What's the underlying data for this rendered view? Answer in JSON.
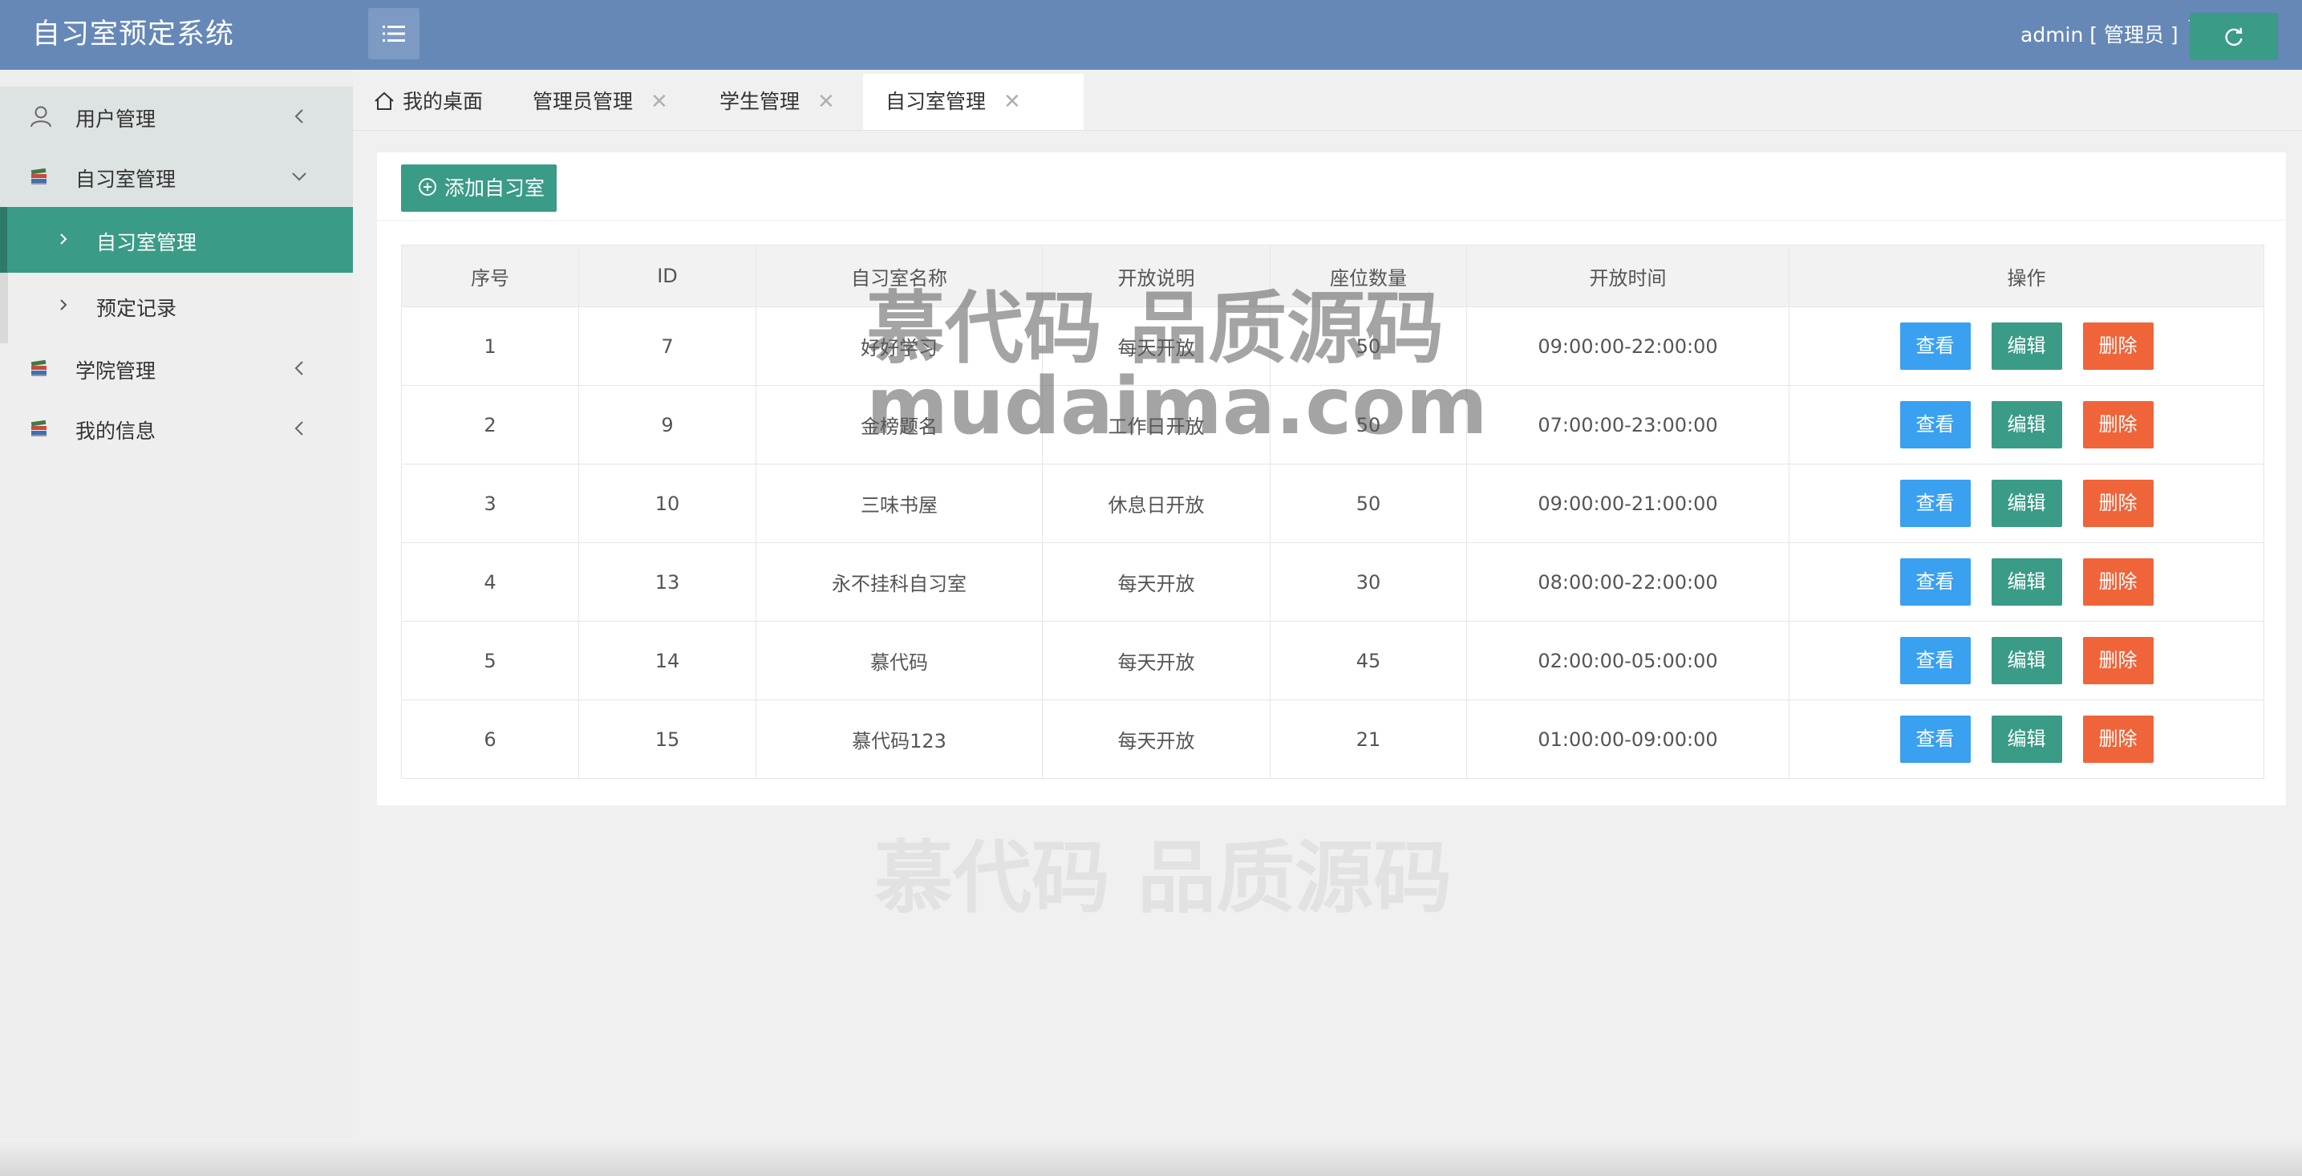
{
  "header": {
    "app_title": "自习室预定系统",
    "user_label": "admin [ 管理员 ]"
  },
  "sidebar": {
    "items": [
      {
        "label": "用户管理",
        "icon": "user-icon",
        "state": "collapsed"
      },
      {
        "label": "自习室管理",
        "icon": "books-icon",
        "state": "expanded"
      },
      {
        "label": "学院管理",
        "icon": "books-icon",
        "state": "collapsed"
      },
      {
        "label": "我的信息",
        "icon": "books-icon",
        "state": "collapsed"
      }
    ],
    "subitems": [
      {
        "label": "自习室管理",
        "active": true
      },
      {
        "label": "预定记录",
        "active": false
      }
    ]
  },
  "tabs": [
    {
      "label": "我的桌面",
      "closable": false,
      "icon": "home-icon"
    },
    {
      "label": "管理员管理",
      "closable": true
    },
    {
      "label": "学生管理",
      "closable": true
    },
    {
      "label": "自习室管理",
      "closable": true,
      "active": true
    }
  ],
  "toolbar": {
    "add_label": "添加自习室"
  },
  "table": {
    "columns": [
      "序号",
      "ID",
      "自习室名称",
      "开放说明",
      "座位数量",
      "开放时间",
      "操作"
    ],
    "rows": [
      [
        "1",
        "7",
        "好好学习",
        "每天开放",
        "50",
        "09:00:00-22:00:00"
      ],
      [
        "2",
        "9",
        "金榜题名",
        "工作日开放",
        "50",
        "07:00:00-23:00:00"
      ],
      [
        "3",
        "10",
        "三味书屋",
        "休息日开放",
        "50",
        "09:00:00-21:00:00"
      ],
      [
        "4",
        "13",
        "永不挂科自习室",
        "每天开放",
        "30",
        "08:00:00-22:00:00"
      ],
      [
        "5",
        "14",
        "慕代码",
        "每天开放",
        "45",
        "02:00:00-05:00:00"
      ],
      [
        "6",
        "15",
        "慕代码123",
        "每天开放",
        "21",
        "01:00:00-09:00:00"
      ]
    ],
    "actions": {
      "view": "查看",
      "edit": "编辑",
      "delete": "删除"
    }
  },
  "watermark": {
    "line1": "慕代码 品质源码",
    "line2": "mudaima.com"
  },
  "colors": {
    "header": "#6688b7",
    "accent": "#3a9b86",
    "view": "#3aa0f0",
    "delete": "#f0643a"
  }
}
